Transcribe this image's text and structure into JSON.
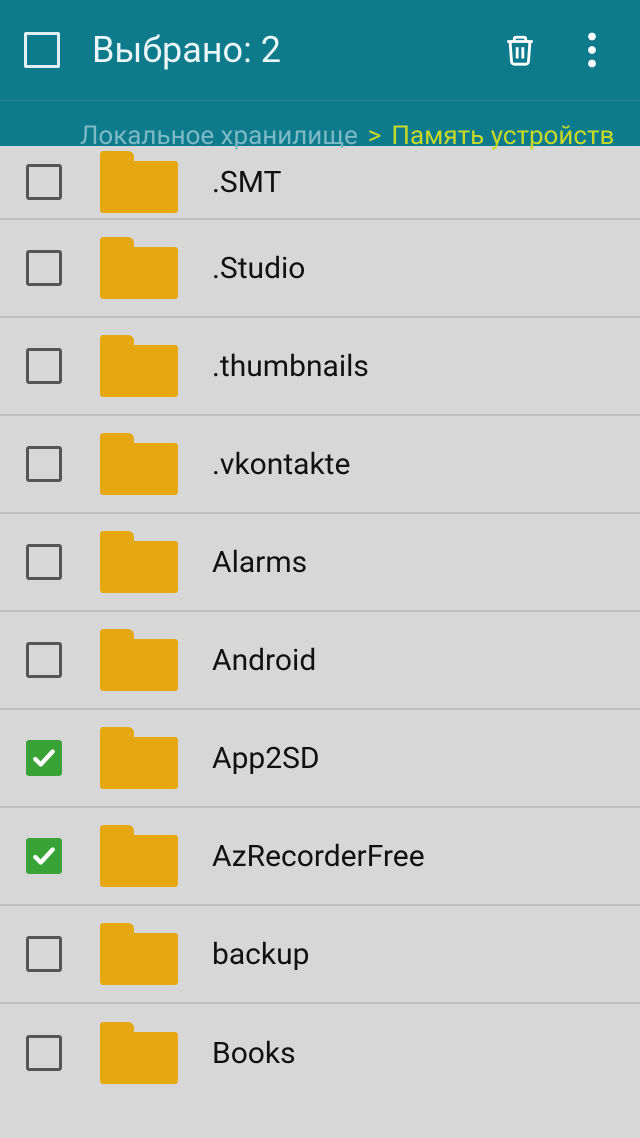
{
  "header": {
    "title": "Выбрано: 2"
  },
  "breadcrumb": {
    "root": "Локальное хранилище",
    "sep": ">",
    "current": "Память устройств"
  },
  "items": [
    {
      "name": ".SMT",
      "checked": false
    },
    {
      "name": ".Studio",
      "checked": false
    },
    {
      "name": ".thumbnails",
      "checked": false
    },
    {
      "name": ".vkontakte",
      "checked": false
    },
    {
      "name": "Alarms",
      "checked": false
    },
    {
      "name": "Android",
      "checked": false
    },
    {
      "name": "App2SD",
      "checked": true
    },
    {
      "name": "AzRecorderFree",
      "checked": true
    },
    {
      "name": "backup",
      "checked": false
    },
    {
      "name": "Books",
      "checked": false
    }
  ]
}
